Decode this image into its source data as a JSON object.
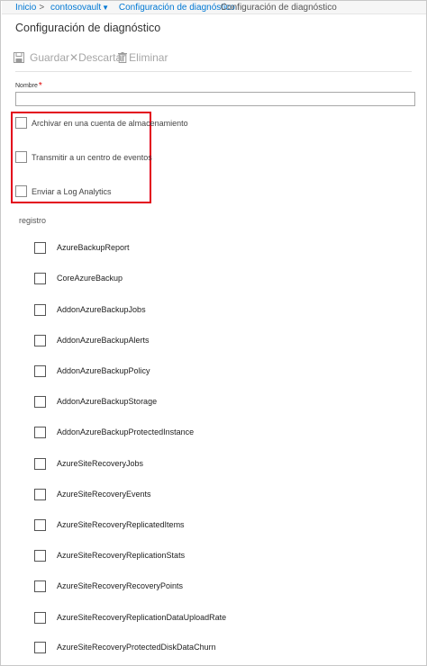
{
  "breadcrumb": {
    "home": "Inicio",
    "vault": "contosovault",
    "section": "Configuración de diagnóstico",
    "current": "Configuración de diagnóstico"
  },
  "page": {
    "title": "Configuración de diagnóstico"
  },
  "toolbar": {
    "save_label": "Guardar",
    "discard_label": "Descartar",
    "delete_label": "Eliminar"
  },
  "form": {
    "name_label": "Nombre",
    "name_required_mark": "*",
    "name_value": "",
    "destinations": [
      {
        "label": "Archivar en una cuenta de almacenamiento",
        "checked": false
      },
      {
        "label": "Transmitir a un centro de eventos",
        "checked": false
      },
      {
        "label": "Enviar a Log Analytics",
        "checked": false
      }
    ]
  },
  "logs": {
    "title": "registro",
    "categories": [
      {
        "label": "AzureBackupReport",
        "checked": false
      },
      {
        "label": "CoreAzureBackup",
        "checked": false
      },
      {
        "label": "AddonAzureBackupJobs",
        "checked": false
      },
      {
        "label": "AddonAzureBackupAlerts",
        "checked": false
      },
      {
        "label": "AddonAzureBackupPolicy",
        "checked": false
      },
      {
        "label": "AddonAzureBackupStorage",
        "checked": false
      },
      {
        "label": "AddonAzureBackupProtectedInstance",
        "checked": false
      },
      {
        "label": "AzureSiteRecoveryJobs",
        "checked": false
      },
      {
        "label": "AzureSiteRecoveryEvents",
        "checked": false
      },
      {
        "label": "AzureSiteRecoveryReplicatedItems",
        "checked": false
      },
      {
        "label": "AzureSiteRecoveryReplicationStats",
        "checked": false
      },
      {
        "label": "AzureSiteRecoveryRecoveryPoints",
        "checked": false
      },
      {
        "label": "AzureSiteRecoveryReplicationDataUploadRate",
        "checked": false
      },
      {
        "label": "AzureSiteRecoveryProtectedDiskDataChurn",
        "checked": false
      }
    ]
  },
  "icons": {
    "save": "save-icon",
    "discard": "x-icon",
    "delete": "trash-icon",
    "vault_dropdown": "chevron-down-icon"
  },
  "colors": {
    "link": "#0078d4",
    "highlight": "#e3001b",
    "required": "#e00000",
    "disabled_text": "#a6a6a6"
  }
}
